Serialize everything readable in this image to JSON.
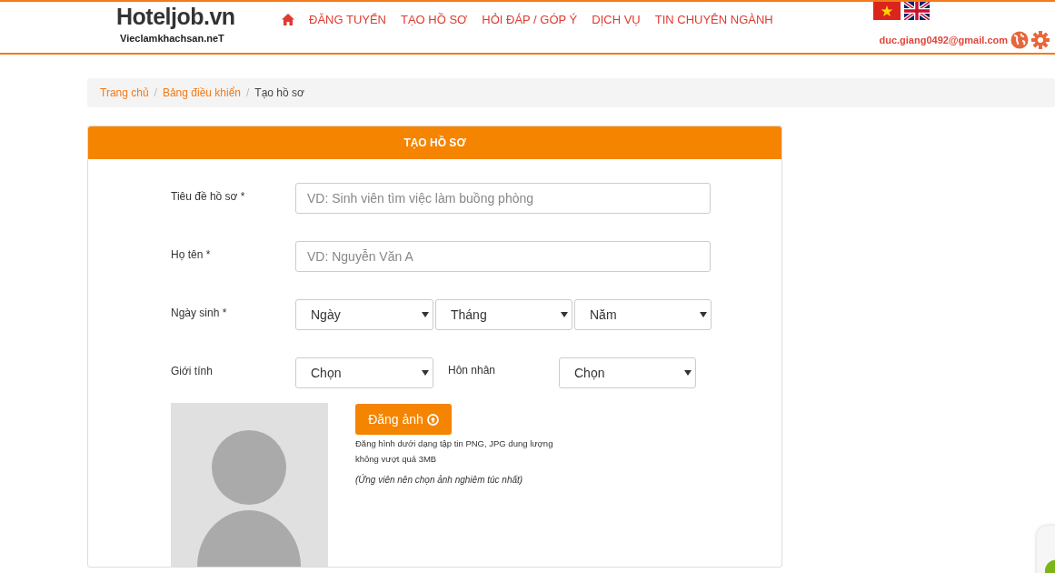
{
  "header": {
    "logo": {
      "name": "Hoteljob.vn",
      "tagline": "Vieclamkhachsan.neT"
    },
    "nav": [
      {
        "kind": "home"
      },
      {
        "label": "ĐĂNG TUYỂN"
      },
      {
        "label": "TẠO HỒ SƠ"
      },
      {
        "label": "HỎI ĐÁP / GÓP Ý"
      },
      {
        "label": "DỊCH VỤ"
      },
      {
        "label": "TIN CHUYÊN NGÀNH"
      }
    ],
    "languages": [
      {
        "kind": "vn"
      },
      {
        "kind": "uk"
      }
    ],
    "user_email": "duc.giang0492@gmail.com"
  },
  "breadcrumb": [
    {
      "label": "Trang chủ",
      "link": true
    },
    {
      "separator": "/",
      "label": "Bảng điều khiển",
      "link": true
    },
    {
      "separator": "/",
      "label": "Tạo hồ sơ",
      "link": false
    }
  ],
  "panel": {
    "title": "TẠO HỒ SƠ",
    "rows": [
      {
        "kind": "text",
        "label": "Tiêu đề hồ sơ *",
        "placeholder": "VD: Sinh viên tìm việc làm buồng phòng"
      },
      {
        "kind": "text",
        "label": "Họ tên *",
        "placeholder": "VD: Nguyễn Văn A"
      },
      {
        "kind": "selects",
        "label": "Ngày sinh *",
        "selects": [
          {
            "value": "Ngày"
          },
          {
            "value": "Tháng"
          },
          {
            "value": "Năm"
          }
        ]
      },
      {
        "kind": "pair",
        "label": "Giới tính",
        "selects": [
          {
            "value": "Chọn"
          }
        ],
        "label_2": "Hôn nhân",
        "selects_2": [
          {
            "value": "Chọn"
          }
        ]
      }
    ],
    "upload": {
      "button": "Đăng ảnh",
      "hint": "Đăng hình dưới dạng tập tin PNG, JPG dung lượng không vượt quá 3MB",
      "note": "(Ứng viên nên chọn ảnh nghiêm túc nhất)"
    }
  }
}
